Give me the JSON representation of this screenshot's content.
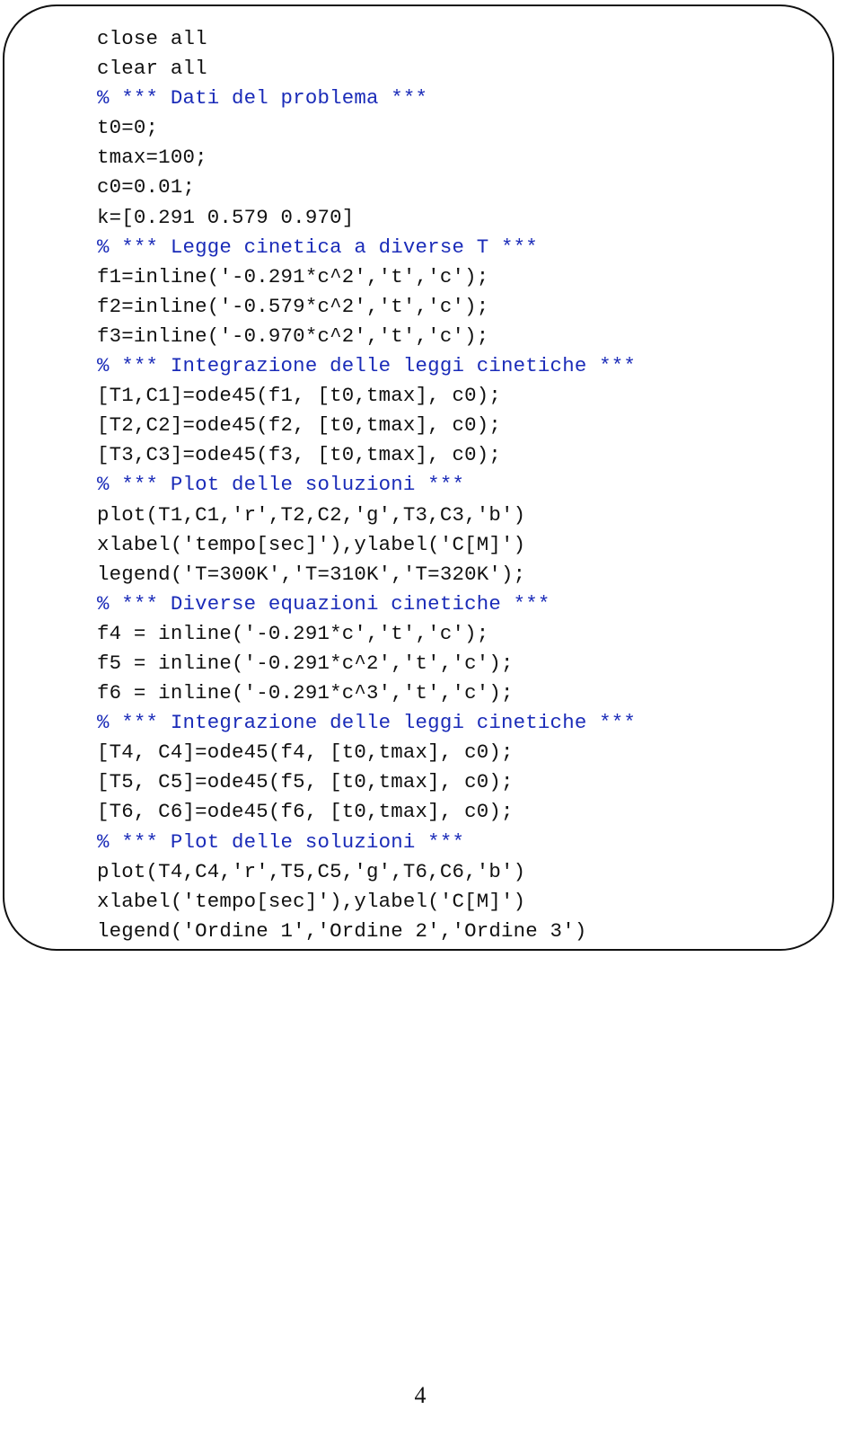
{
  "document": {
    "colors": {
      "code": "#111111",
      "comment": "#1a2bb8",
      "border": "#111111"
    },
    "code_lines": [
      {
        "text": "close all",
        "type": "code"
      },
      {
        "text": "clear all",
        "type": "code"
      },
      {
        "text": "% *** Dati del problema ***",
        "type": "comment"
      },
      {
        "text": "t0=0;",
        "type": "code"
      },
      {
        "text": "tmax=100;",
        "type": "code"
      },
      {
        "text": "c0=0.01;",
        "type": "code"
      },
      {
        "text": "k=[0.291 0.579 0.970]",
        "type": "code"
      },
      {
        "text": "% *** Legge cinetica a diverse T ***",
        "type": "comment"
      },
      {
        "text": "f1=inline('-0.291*c^2','t','c');",
        "type": "code"
      },
      {
        "text": "f2=inline('-0.579*c^2','t','c');",
        "type": "code"
      },
      {
        "text": "f3=inline('-0.970*c^2','t','c');",
        "type": "code"
      },
      {
        "text": "% *** Integrazione delle leggi cinetiche ***",
        "type": "comment"
      },
      {
        "text": "[T1,C1]=ode45(f1, [t0,tmax], c0);",
        "type": "code"
      },
      {
        "text": "[T2,C2]=ode45(f2, [t0,tmax], c0);",
        "type": "code"
      },
      {
        "text": "[T3,C3]=ode45(f3, [t0,tmax], c0);",
        "type": "code"
      },
      {
        "text": "% *** Plot delle soluzioni ***",
        "type": "comment"
      },
      {
        "text": "plot(T1,C1,'r',T2,C2,'g',T3,C3,'b')",
        "type": "code"
      },
      {
        "text": "xlabel('tempo[sec]'),ylabel('C[M]')",
        "type": "code"
      },
      {
        "text": "legend('T=300K','T=310K','T=320K');",
        "type": "code"
      },
      {
        "text": "% *** Diverse equazioni cinetiche ***",
        "type": "comment"
      },
      {
        "text": "f4 = inline('-0.291*c','t','c');",
        "type": "code"
      },
      {
        "text": "f5 = inline('-0.291*c^2','t','c');",
        "type": "code"
      },
      {
        "text": "f6 = inline('-0.291*c^3','t','c');",
        "type": "code"
      },
      {
        "text": "% *** Integrazione delle leggi cinetiche ***",
        "type": "comment"
      },
      {
        "text": "[T4, C4]=ode45(f4, [t0,tmax], c0);",
        "type": "code"
      },
      {
        "text": "[T5, C5]=ode45(f5, [t0,tmax], c0);",
        "type": "code"
      },
      {
        "text": "[T6, C6]=ode45(f6, [t0,tmax], c0);",
        "type": "code"
      },
      {
        "text": "% *** Plot delle soluzioni ***",
        "type": "comment"
      },
      {
        "text": "plot(T4,C4,'r',T5,C5,'g',T6,C6,'b')",
        "type": "code"
      },
      {
        "text": "xlabel('tempo[sec]'),ylabel('C[M]')",
        "type": "code"
      },
      {
        "text": "legend('Ordine 1','Ordine 2','Ordine 3')",
        "type": "code"
      }
    ],
    "page_number": "4"
  }
}
